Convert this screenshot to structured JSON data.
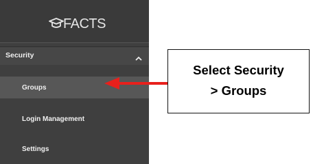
{
  "app": {
    "logo_text": "FACTS",
    "logo_icon": "graduation-cap-icon"
  },
  "sidebar": {
    "section": {
      "label": "Security",
      "expanded": true,
      "chevron_icon": "chevron-up-icon"
    },
    "items": [
      {
        "label": "Groups",
        "active": true
      },
      {
        "label": "Login Management",
        "active": false
      },
      {
        "label": "Settings",
        "active": false
      }
    ]
  },
  "callout": {
    "line1": "Select Security",
    "line2": "> Groups"
  },
  "colors": {
    "sidebar_bg": "#3f3f3f",
    "active_item_bg": "#575757",
    "arrow": "#e8201c"
  }
}
